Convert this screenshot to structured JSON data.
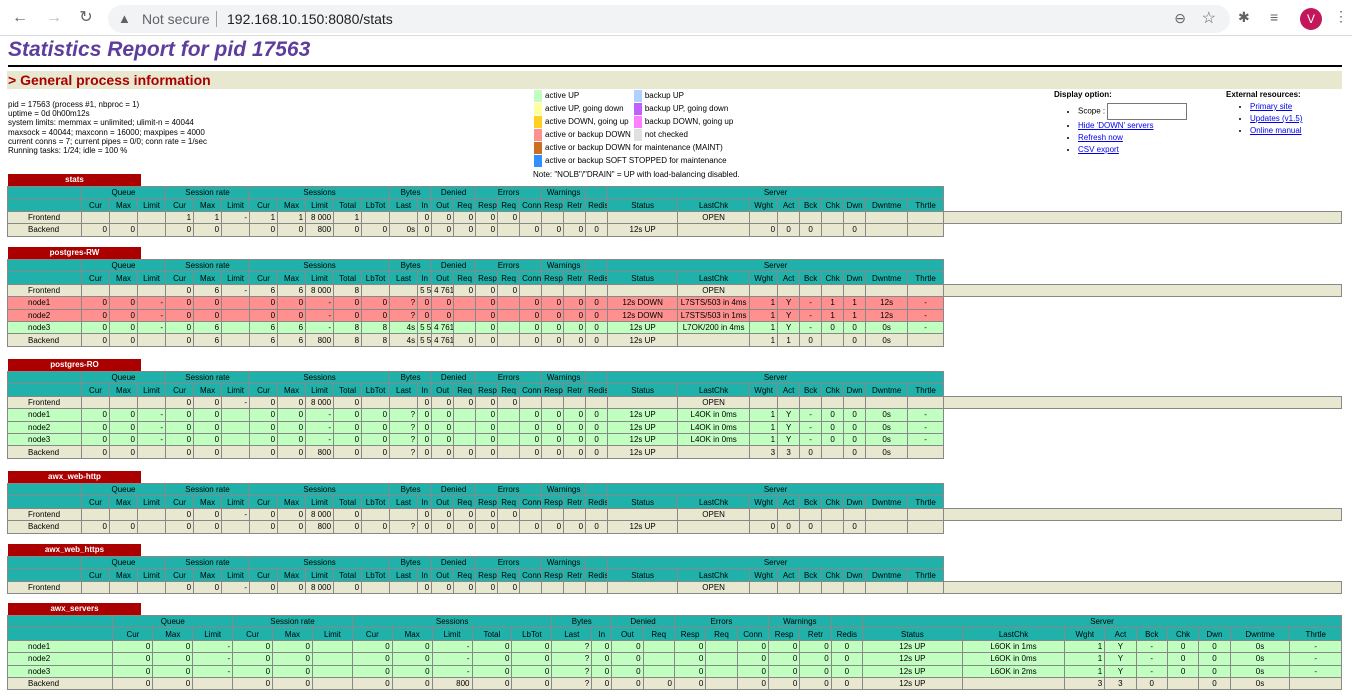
{
  "browser": {
    "security": "Not secure",
    "url": "192.168.10.150:8080/stats",
    "avatar": "V"
  },
  "page": {
    "title": "Statistics Report for pid 17563",
    "section": "> General process information",
    "pinfo": [
      "pid = 17563 (process #1, nbproc = 1)",
      "uptime = 0d 0h00m12s",
      "system limits: memmax = unlimited; ulimit-n = 40044",
      "maxsock = 40044; maxconn = 16000; maxpipes = 4000",
      "current conns = 7; current pipes = 0/0; conn rate = 1/sec",
      "Running tasks: 1/24; idle = 100 %"
    ]
  },
  "legend": {
    "items": [
      {
        "c": "#c0ffc0",
        "t": "active UP"
      },
      {
        "c": "#b0d0ff",
        "t": "backup UP"
      },
      {
        "c": "#ffffa0",
        "t": "active UP, going down"
      },
      {
        "c": "#c060ff",
        "t": "backup UP, going down"
      },
      {
        "c": "#ffd020",
        "t": "active DOWN, going up"
      },
      {
        "c": "#ff80ff",
        "t": "backup DOWN, going up"
      },
      {
        "c": "#ff9090",
        "t": "active or backup DOWN"
      },
      {
        "c": "#e0e0e0",
        "t": "not checked"
      },
      {
        "c": "#cc7020",
        "t": "active or backup DOWN for maintenance (MAINT)"
      },
      {
        "c": "#3090ff",
        "t": "active or backup SOFT STOPPED for maintenance"
      }
    ],
    "note": "Note: \"NOLB\"/\"DRAIN\" = UP with load-balancing disabled."
  },
  "display": {
    "title": "Display option:",
    "scope": "Scope :",
    "links": [
      "Hide 'DOWN' servers",
      "Refresh now",
      "CSV export"
    ]
  },
  "external": {
    "title": "External resources:",
    "links": [
      "Primary site",
      "Updates (v1.5)",
      "Online manual"
    ]
  },
  "headers": {
    "groups": [
      "Queue",
      "Session rate",
      "Sessions",
      "Bytes",
      "Denied",
      "Errors",
      "Warnings",
      "Server"
    ],
    "cols": [
      "Cur",
      "Max",
      "Limit",
      "Cur",
      "Max",
      "Limit",
      "Cur",
      "Max",
      "Limit",
      "Total",
      "LbTot",
      "Last",
      "In",
      "Out",
      "Req",
      "Resp",
      "Req",
      "Conn",
      "Resp",
      "Retr",
      "Redis",
      "Status",
      "LastChk",
      "Wght",
      "Act",
      "Bck",
      "Chk",
      "Dwn",
      "Dwntme",
      "Thrtle"
    ]
  },
  "proxies": [
    {
      "name": "stats",
      "rows": [
        {
          "t": "fe",
          "c": [
            "Frontend",
            "",
            "",
            "",
            "1",
            "1",
            "-",
            "1",
            "1",
            "8 000",
            "1",
            "",
            "",
            "0",
            "0",
            "0",
            "0",
            "0",
            "",
            "",
            "",
            "",
            "",
            "OPEN",
            "",
            "",
            "",
            "",
            "",
            "",
            "",
            ""
          ]
        },
        {
          "t": "be",
          "c": [
            "Backend",
            "0",
            "0",
            "",
            "0",
            "0",
            "",
            "0",
            "0",
            "800",
            "0",
            "0",
            "0s",
            "0",
            "0",
            "0",
            "0",
            "",
            "0",
            "0",
            "0",
            "0",
            "12s UP",
            "",
            "0",
            "0",
            "0",
            "",
            "0",
            "",
            ""
          ]
        }
      ]
    },
    {
      "name": "postgres-RW",
      "rows": [
        {
          "t": "fe",
          "c": [
            "Frontend",
            "",
            "",
            "",
            "0",
            "6",
            "-",
            "6",
            "6",
            "8 000",
            "8",
            "",
            "",
            "5 590",
            "4 761",
            "0",
            "0",
            "0",
            "",
            "",
            "",
            "",
            "",
            "OPEN",
            "",
            "",
            "",
            "",
            "",
            "",
            "",
            ""
          ]
        },
        {
          "t": "dn",
          "c": [
            "node1",
            "0",
            "0",
            "-",
            "0",
            "0",
            "",
            "0",
            "0",
            "-",
            "0",
            "0",
            "?",
            "0",
            "0",
            "",
            "0",
            "",
            "0",
            "0",
            "0",
            "0",
            "12s DOWN",
            "L7STS/503 in 4ms",
            "1",
            "Y",
            "-",
            "1",
            "1",
            "12s",
            "-"
          ]
        },
        {
          "t": "dn",
          "c": [
            "node2",
            "0",
            "0",
            "-",
            "0",
            "0",
            "",
            "0",
            "0",
            "-",
            "0",
            "0",
            "?",
            "0",
            "0",
            "",
            "0",
            "",
            "0",
            "0",
            "0",
            "0",
            "12s DOWN",
            "L7STS/503 in 1ms",
            "1",
            "Y",
            "-",
            "1",
            "1",
            "12s",
            "-"
          ]
        },
        {
          "t": "up",
          "c": [
            "node3",
            "0",
            "0",
            "-",
            "0",
            "6",
            "",
            "6",
            "6",
            "-",
            "8",
            "8",
            "4s",
            "5 590",
            "4 761",
            "",
            "0",
            "",
            "0",
            "0",
            "0",
            "0",
            "12s UP",
            "L7OK/200 in 4ms",
            "1",
            "Y",
            "-",
            "0",
            "0",
            "0s",
            "-"
          ]
        },
        {
          "t": "be",
          "c": [
            "Backend",
            "0",
            "0",
            "",
            "0",
            "6",
            "",
            "6",
            "6",
            "800",
            "8",
            "8",
            "4s",
            "5 590",
            "4 761",
            "0",
            "0",
            "",
            "0",
            "0",
            "0",
            "0",
            "12s UP",
            "",
            "1",
            "1",
            "0",
            "",
            "0",
            "0s",
            ""
          ]
        }
      ]
    },
    {
      "name": "postgres-RO",
      "rows": [
        {
          "t": "fe",
          "c": [
            "Frontend",
            "",
            "",
            "",
            "0",
            "0",
            "-",
            "0",
            "0",
            "8 000",
            "0",
            "",
            "",
            "0",
            "0",
            "0",
            "0",
            "0",
            "",
            "",
            "",
            "",
            "",
            "OPEN",
            "",
            "",
            "",
            "",
            "",
            "",
            "",
            ""
          ]
        },
        {
          "t": "up",
          "c": [
            "node1",
            "0",
            "0",
            "-",
            "0",
            "0",
            "",
            "0",
            "0",
            "-",
            "0",
            "0",
            "?",
            "0",
            "0",
            "",
            "0",
            "",
            "0",
            "0",
            "0",
            "0",
            "12s UP",
            "L4OK in 0ms",
            "1",
            "Y",
            "-",
            "0",
            "0",
            "0s",
            "-"
          ]
        },
        {
          "t": "up",
          "c": [
            "node2",
            "0",
            "0",
            "-",
            "0",
            "0",
            "",
            "0",
            "0",
            "-",
            "0",
            "0",
            "?",
            "0",
            "0",
            "",
            "0",
            "",
            "0",
            "0",
            "0",
            "0",
            "12s UP",
            "L4OK in 0ms",
            "1",
            "Y",
            "-",
            "0",
            "0",
            "0s",
            "-"
          ]
        },
        {
          "t": "up",
          "c": [
            "node3",
            "0",
            "0",
            "-",
            "0",
            "0",
            "",
            "0",
            "0",
            "-",
            "0",
            "0",
            "?",
            "0",
            "0",
            "",
            "0",
            "",
            "0",
            "0",
            "0",
            "0",
            "12s UP",
            "L4OK in 0ms",
            "1",
            "Y",
            "-",
            "0",
            "0",
            "0s",
            "-"
          ]
        },
        {
          "t": "be",
          "c": [
            "Backend",
            "0",
            "0",
            "",
            "0",
            "0",
            "",
            "0",
            "0",
            "800",
            "0",
            "0",
            "?",
            "0",
            "0",
            "0",
            "0",
            "",
            "0",
            "0",
            "0",
            "0",
            "12s UP",
            "",
            "3",
            "3",
            "0",
            "",
            "0",
            "0s",
            ""
          ]
        }
      ]
    },
    {
      "name": "awx_web-http",
      "rows": [
        {
          "t": "fe",
          "c": [
            "Frontend",
            "",
            "",
            "",
            "0",
            "0",
            "-",
            "0",
            "0",
            "8 000",
            "0",
            "",
            "",
            "0",
            "0",
            "0",
            "0",
            "0",
            "",
            "",
            "",
            "",
            "",
            "OPEN",
            "",
            "",
            "",
            "",
            "",
            "",
            "",
            ""
          ]
        },
        {
          "t": "be",
          "c": [
            "Backend",
            "0",
            "0",
            "",
            "0",
            "0",
            "",
            "0",
            "0",
            "800",
            "0",
            "0",
            "?",
            "0",
            "0",
            "0",
            "0",
            "",
            "0",
            "0",
            "0",
            "0",
            "12s UP",
            "",
            "0",
            "0",
            "0",
            "",
            "0",
            "",
            ""
          ]
        }
      ]
    },
    {
      "name": "awx_web_https",
      "rows": [
        {
          "t": "fe",
          "c": [
            "Frontend",
            "",
            "",
            "",
            "0",
            "0",
            "-",
            "0",
            "0",
            "8 000",
            "0",
            "",
            "",
            "0",
            "0",
            "0",
            "0",
            "0",
            "",
            "",
            "",
            "",
            "",
            "OPEN",
            "",
            "",
            "",
            "",
            "",
            "",
            "",
            ""
          ]
        }
      ]
    },
    {
      "name": "awx_servers",
      "rows": [
        {
          "t": "up",
          "c": [
            "node1",
            "0",
            "0",
            "-",
            "0",
            "0",
            "",
            "0",
            "0",
            "-",
            "0",
            "0",
            "?",
            "0",
            "0",
            "",
            "0",
            "",
            "0",
            "0",
            "0",
            "0",
            "12s UP",
            "L6OK in 1ms",
            "1",
            "Y",
            "-",
            "0",
            "0",
            "0s",
            "-"
          ]
        },
        {
          "t": "up",
          "c": [
            "node2",
            "0",
            "0",
            "-",
            "0",
            "0",
            "",
            "0",
            "0",
            "-",
            "0",
            "0",
            "?",
            "0",
            "0",
            "",
            "0",
            "",
            "0",
            "0",
            "0",
            "0",
            "12s UP",
            "L6OK in 0ms",
            "1",
            "Y",
            "-",
            "0",
            "0",
            "0s",
            "-"
          ]
        },
        {
          "t": "up",
          "c": [
            "node3",
            "0",
            "0",
            "-",
            "0",
            "0",
            "",
            "0",
            "0",
            "-",
            "0",
            "0",
            "?",
            "0",
            "0",
            "",
            "0",
            "",
            "0",
            "0",
            "0",
            "0",
            "12s UP",
            "L6OK in 2ms",
            "1",
            "Y",
            "-",
            "0",
            "0",
            "0s",
            "-"
          ]
        },
        {
          "t": "be",
          "c": [
            "Backend",
            "0",
            "0",
            "",
            "0",
            "0",
            "",
            "0",
            "0",
            "800",
            "0",
            "0",
            "?",
            "0",
            "0",
            "0",
            "0",
            "",
            "0",
            "0",
            "0",
            "0",
            "12s UP",
            "",
            "3",
            "3",
            "0",
            "",
            "0",
            "0s",
            ""
          ]
        }
      ]
    }
  ]
}
